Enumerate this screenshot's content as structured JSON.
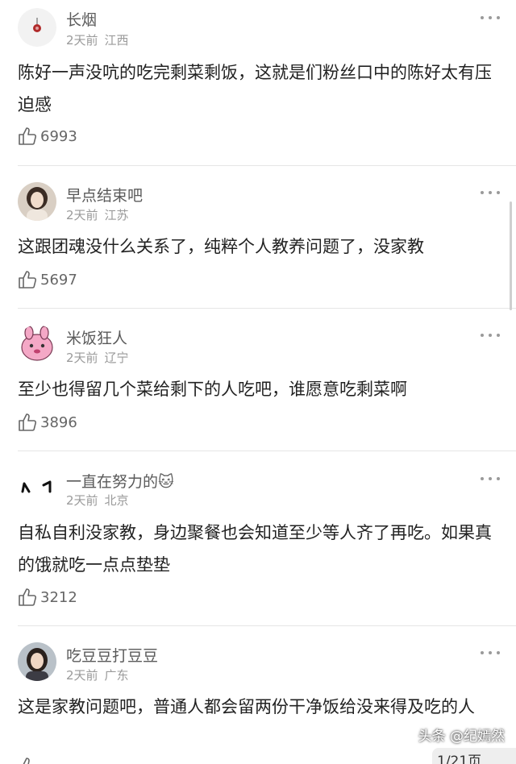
{
  "comments": [
    {
      "username": "长烟",
      "time": "2天前",
      "location": "江西",
      "text": "陈好一声没吭的吃完剩菜剩饭，这就是们粉丝口中的陈好太有压迫感",
      "likes": "6993",
      "avatar_icon": "red-knot-avatar"
    },
    {
      "username": "早点结束吧",
      "time": "2天前",
      "location": "江苏",
      "text": "这跟团魂没什么关系了，纯粹个人教养问题了，没家教",
      "likes": "5697",
      "avatar_icon": "girl-photo-avatar"
    },
    {
      "username": "米饭狂人",
      "time": "2天前",
      "location": "辽宁",
      "text": "至少也得留几个菜给剩下的人吃吧，谁愿意吃剩菜啊",
      "likes": "3896",
      "avatar_icon": "pink-bunny-avatar"
    },
    {
      "username": "一直在努力的🐱",
      "time": "2天前",
      "location": "北京",
      "text": "自私自利没家教，身边聚餐也会知道至少等人齐了再吃。如果真的饿就吃一点点垫垫",
      "likes": "3212",
      "avatar_icon": "doodle-avatar"
    },
    {
      "username": "吃豆豆打豆豆",
      "time": "2天前",
      "location": "广东",
      "text": "这是家教问题吧，普通人都会留两份干净饭给没来得及吃的人",
      "likes": "",
      "avatar_icon": "woman-photo-avatar"
    }
  ],
  "watermark": "头条 @纪嫣然",
  "pager": "1/21页",
  "colors": {
    "text": "#222222",
    "username": "#5a5a5a",
    "meta": "#9a9a9a",
    "divider": "#e6e6e6"
  }
}
